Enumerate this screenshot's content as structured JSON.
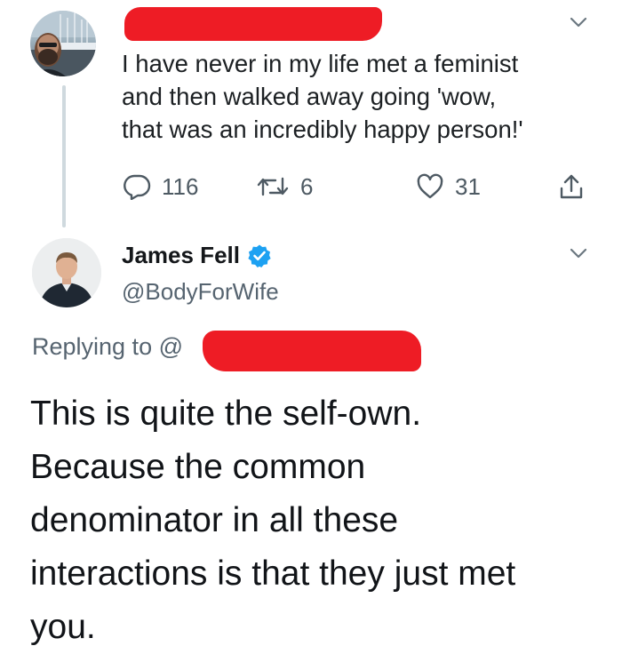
{
  "original_tweet": {
    "author_redacted": true,
    "text": "I have never in my life met a feminist\nand then walked away going 'wow,\nthat was an incredibly happy person!'",
    "actions": {
      "replies": "116",
      "retweets": "6",
      "likes": "31"
    },
    "icons": [
      "reply-icon",
      "retweet-icon",
      "like-icon",
      "share-icon",
      "chevron-down-icon"
    ]
  },
  "reply_tweet": {
    "display_name": "James Fell",
    "verified": true,
    "handle": "@BodyForWife",
    "replying_to_prefix": "Replying to @",
    "text": "This is quite the self-own.\nBecause the common\ndenominator in all these\ninteractions is that they just met\nyou."
  },
  "colors": {
    "redaction": "#ee1c25",
    "verified_blue": "#1da1f2",
    "secondary_text": "#566470",
    "thread_line": "#cfd9de"
  }
}
